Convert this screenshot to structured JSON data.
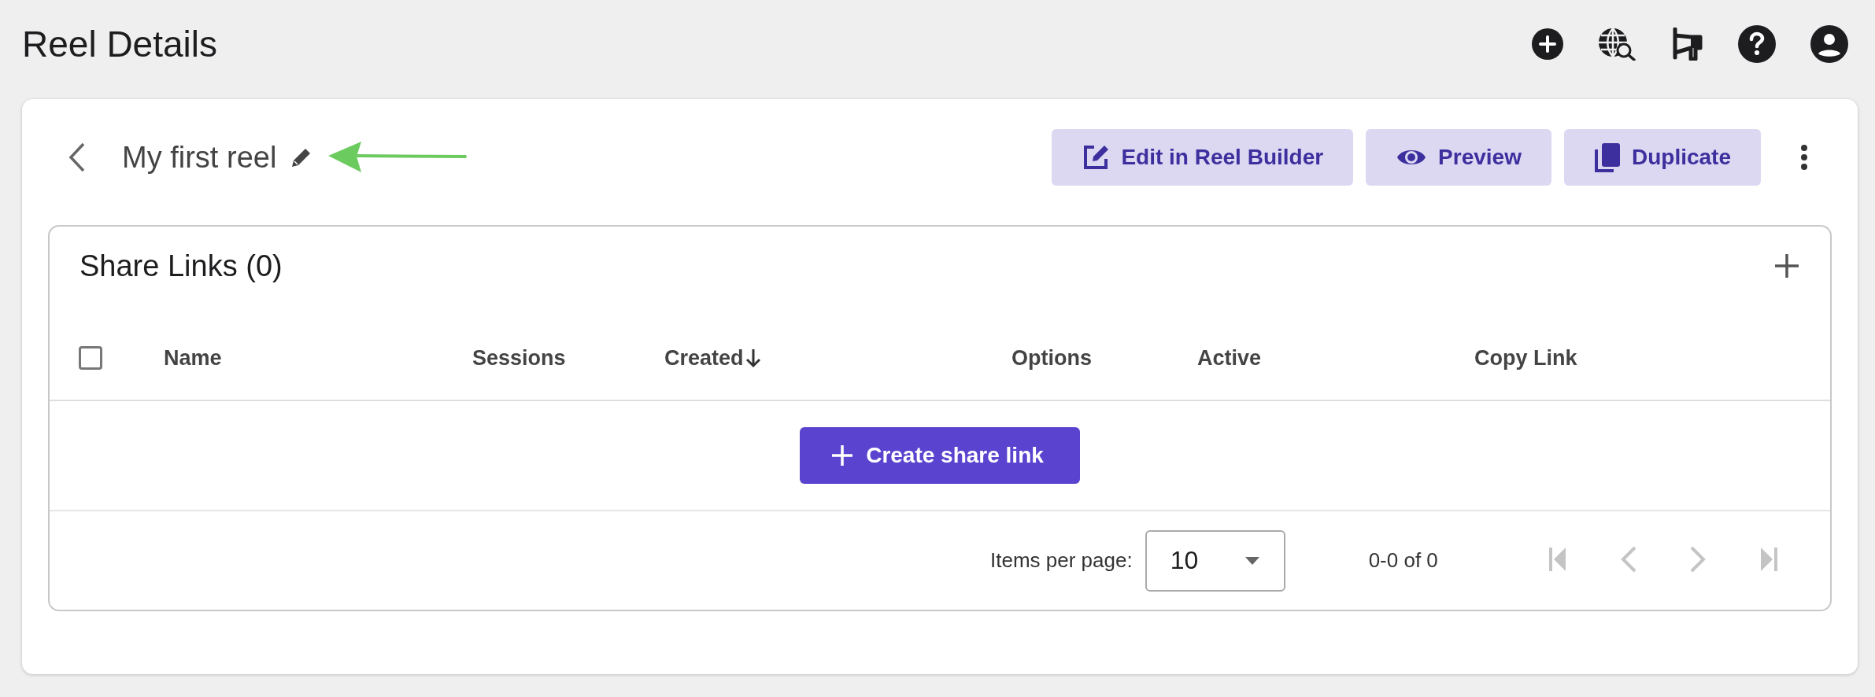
{
  "page": {
    "title": "Reel Details"
  },
  "reel": {
    "name": "My first reel"
  },
  "actions": [
    {
      "kind": "edit",
      "label": "Edit in Reel Builder"
    },
    {
      "kind": "preview",
      "label": "Preview"
    },
    {
      "kind": "duplicate",
      "label": "Duplicate"
    }
  ],
  "share_links": {
    "title": "Share Links (0)",
    "select_all": {
      "checked": false
    },
    "columns": [
      {
        "label": "Name",
        "sorted": false
      },
      {
        "label": "Sessions",
        "sorted": false
      },
      {
        "label": "Created",
        "sorted": true
      },
      {
        "label": "Options",
        "sorted": false
      },
      {
        "label": "Active",
        "sorted": false
      },
      {
        "label": "Copy Link",
        "sorted": false
      }
    ],
    "create_button": "Create share link",
    "paginator": {
      "items_per_page_label": "Items per page:",
      "page_size": "10",
      "range": "0-0 of 0",
      "buttons": [
        {
          "kind": "first",
          "disabled": true
        },
        {
          "kind": "prev",
          "disabled": true
        },
        {
          "kind": "next",
          "disabled": true
        },
        {
          "kind": "last",
          "disabled": true
        }
      ]
    }
  }
}
